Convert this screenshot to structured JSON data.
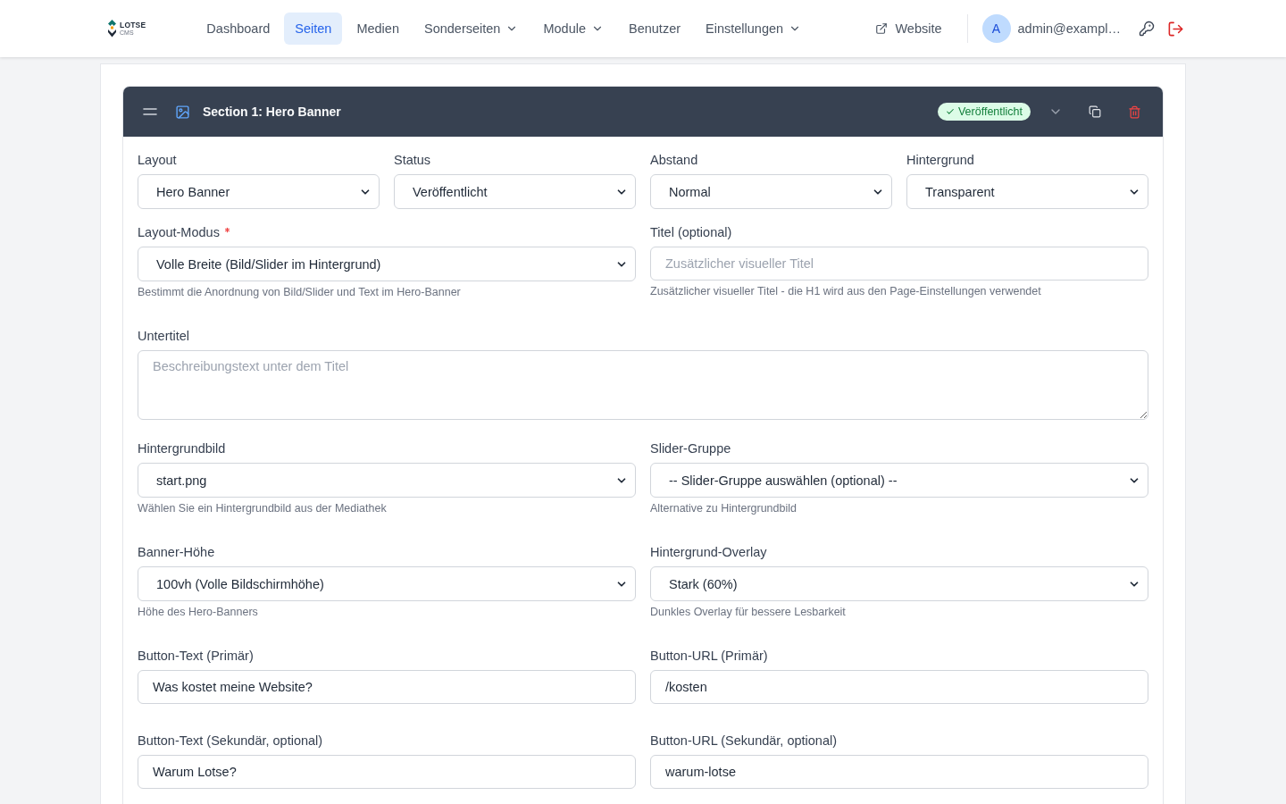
{
  "nav": {
    "logo": {
      "name": "LOTSE",
      "sub": "CMS"
    },
    "items": [
      {
        "label": "Dashboard",
        "selected": false,
        "has_menu": false
      },
      {
        "label": "Seiten",
        "selected": true,
        "has_menu": false
      },
      {
        "label": "Medien",
        "selected": false,
        "has_menu": false
      },
      {
        "label": "Sonderseiten",
        "selected": false,
        "has_menu": true
      },
      {
        "label": "Module",
        "selected": false,
        "has_menu": true
      },
      {
        "label": "Benutzer",
        "selected": false,
        "has_menu": false
      },
      {
        "label": "Einstellungen",
        "selected": false,
        "has_menu": true
      }
    ],
    "website_link": "Website",
    "user": {
      "avatar": "A",
      "email": "admin@exampl…"
    }
  },
  "section": {
    "title": "Section 1: Hero Banner",
    "status_badge": "Veröffentlicht"
  },
  "form": {
    "rows": [
      [
        {
          "label": "Layout",
          "kind": "select",
          "required": false,
          "value": "Hero Banner"
        },
        {
          "label": "Status",
          "kind": "select",
          "required": false,
          "value": "Veröffentlicht"
        },
        {
          "label": "Abstand",
          "kind": "select",
          "required": false,
          "value": "Normal"
        },
        {
          "label": "Hintergrund",
          "kind": "select",
          "required": false,
          "value": "Transparent"
        }
      ],
      [
        {
          "label": "Layout-Modus",
          "kind": "select",
          "required": true,
          "value": "Volle Breite (Bild/Slider im Hintergrund)",
          "help": "Bestimmt die Anordnung von Bild/Slider und Text im Hero-Banner"
        },
        {
          "label": "Titel (optional)",
          "kind": "input",
          "required": false,
          "placeholder": "Zusätzlicher visueller Titel",
          "help": "Zusätzlicher visueller Titel - die H1 wird aus den Page-Einstellungen verwendet"
        }
      ],
      [
        {
          "label": "Untertitel",
          "kind": "textarea",
          "required": false,
          "placeholder": "Beschreibungstext unter dem Titel"
        }
      ],
      [
        {
          "label": "Hintergrundbild",
          "kind": "select",
          "required": false,
          "value": "start.png",
          "help": "Wählen Sie ein Hintergrundbild aus der Mediathek"
        },
        {
          "label": "Slider-Gruppe",
          "kind": "select",
          "required": false,
          "value": "-- Slider-Gruppe auswählen (optional) --",
          "help": "Alternative zu Hintergrundbild"
        }
      ],
      [
        {
          "label": "Banner-Höhe",
          "kind": "select",
          "required": false,
          "value": "100vh (Volle Bildschirmhöhe)",
          "help": "Höhe des Hero-Banners"
        },
        {
          "label": "Hintergrund-Overlay",
          "kind": "select",
          "required": false,
          "value": "Stark (60%)",
          "help": "Dunkles Overlay für bessere Lesbarkeit"
        }
      ],
      [
        {
          "label": "Button-Text (Primär)",
          "kind": "input",
          "required": false,
          "value": "Was kostet meine Website?"
        },
        {
          "label": "Button-URL (Primär)",
          "kind": "input",
          "required": false,
          "value": "/kosten"
        }
      ],
      [
        {
          "label": "Button-Text (Sekundär, optional)",
          "kind": "input",
          "required": false,
          "value": "Warum Lotse?"
        },
        {
          "label": "Button-URL (Sekundär, optional)",
          "kind": "input",
          "required": false,
          "value": "warum-lotse"
        }
      ]
    ]
  }
}
